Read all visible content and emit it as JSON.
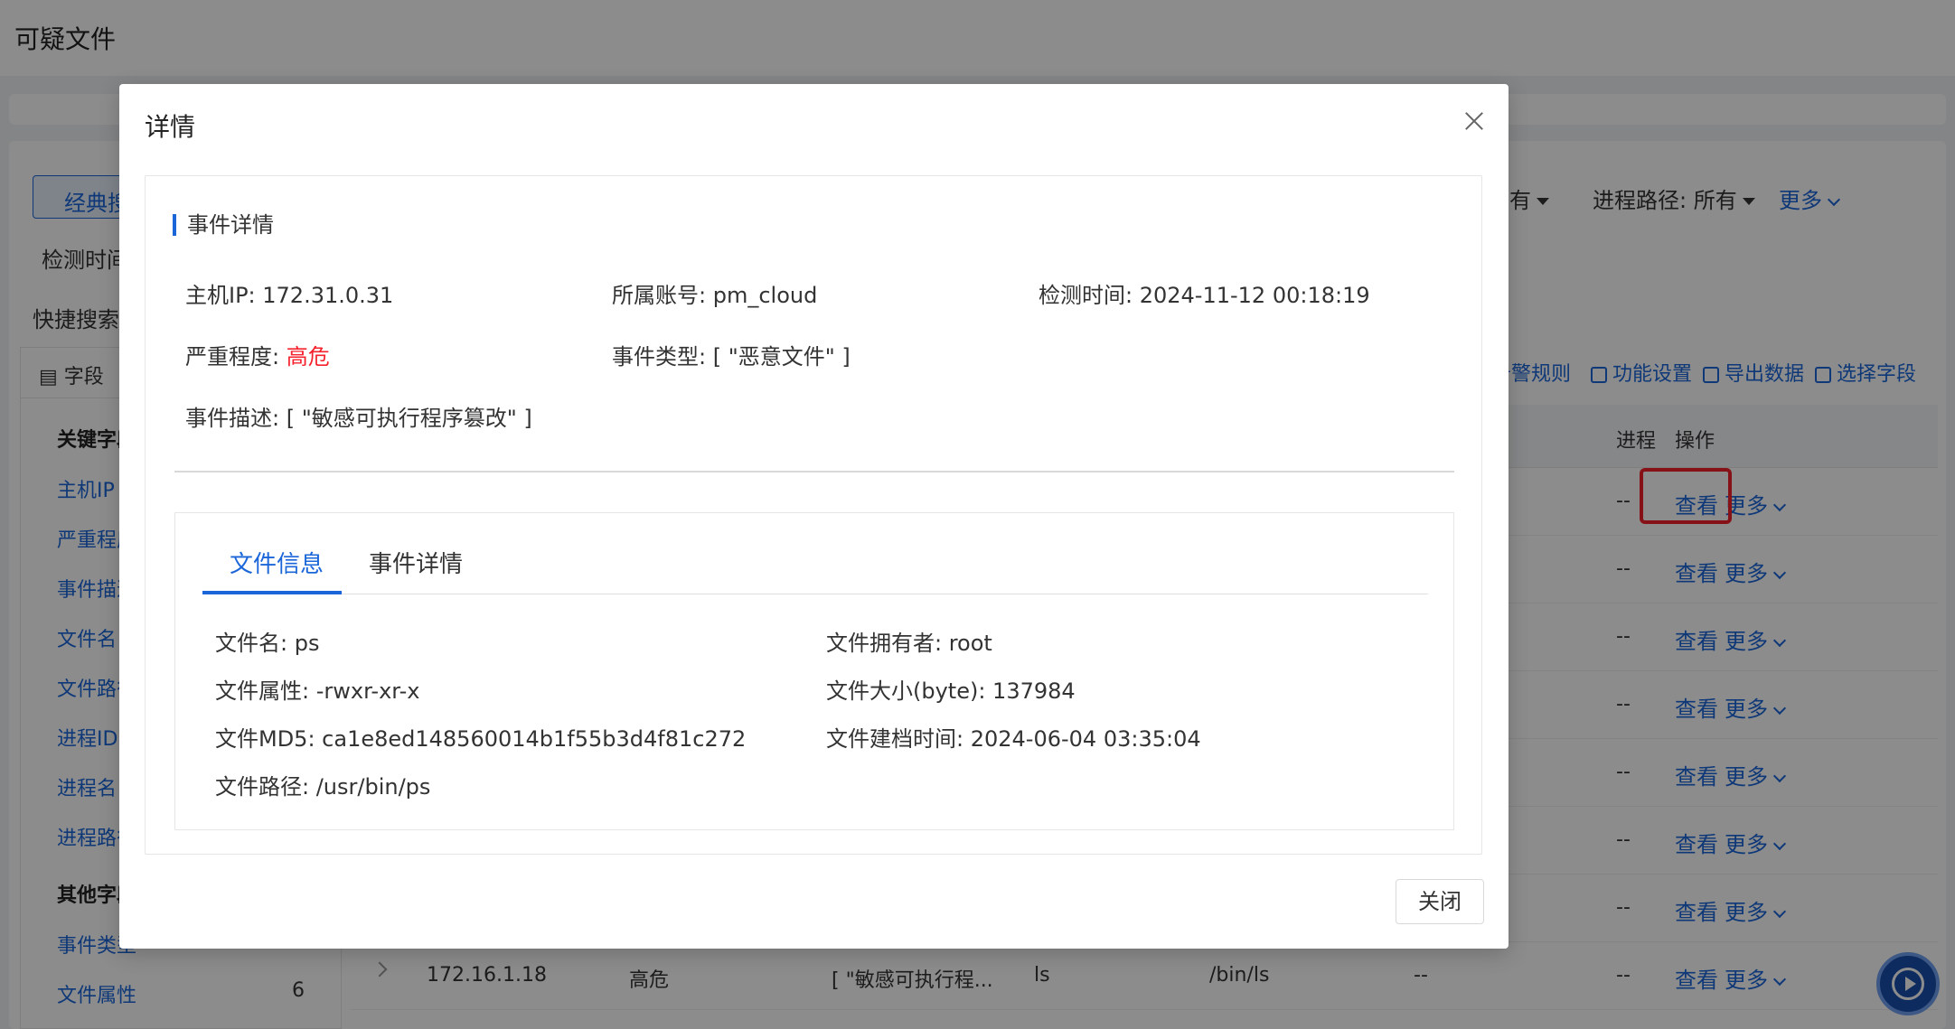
{
  "page": {
    "title": "可疑文件"
  },
  "search": {
    "classic_label": "经典搜",
    "detect_time_label": "检测时间",
    "quick_search_label": "快捷搜索",
    "filter_partial": "有",
    "process_path_filter": "进程路径: 所有",
    "more_label": "更多"
  },
  "toolbar": {
    "alert_rules": "告警规则",
    "feature_settings": "功能设置",
    "export_data": "导出数据",
    "select_fields": "选择字段"
  },
  "left_panel": {
    "header": "字段",
    "key_group": "关键字段",
    "key_items": [
      "主机IP",
      "严重程度",
      "事件描述",
      "文件名",
      "文件路径",
      "进程ID",
      "进程名",
      "进程路径"
    ],
    "other_group": "其他字段",
    "other_items": [
      {
        "label": "事件类型",
        "count": ""
      },
      {
        "label": "文件属性",
        "count": "6"
      }
    ]
  },
  "table": {
    "columns": {
      "process": "进程",
      "op": "操作"
    },
    "rows_placeholder": "--",
    "view_label": "查看",
    "more_label": "更多",
    "visible_row": {
      "ip": "172.16.1.18",
      "severity": "高危",
      "desc": "[ \"敏感可执行程...",
      "file_name": "ls",
      "file_path": "/bin/ls",
      "col6": "--",
      "col7": "--"
    }
  },
  "modal": {
    "title": "详情",
    "section_title": "事件详情",
    "host_ip": "主机IP: 172.31.0.31",
    "account": "所属账号: pm_cloud",
    "detect_time": "检测时间: 2024-11-12 00:18:19",
    "severity_label": "严重程度: ",
    "severity_value": "高危",
    "event_type": "事件类型: [ \"恶意文件\" ]",
    "event_desc": "事件描述: [ \"敏感可执行程序篡改\" ]",
    "tabs": [
      "文件信息",
      "事件详情"
    ],
    "file_info": {
      "name": "文件名: ps",
      "owner": "文件拥有者: root",
      "attr": "文件属性: -rwxr-xr-x",
      "size": "文件大小(byte): 137984",
      "md5": "文件MD5: ca1e8ed148560014b1f55b3d4f81c272",
      "ctime": "文件建档时间: 2024-06-04 03:35:04",
      "path": "文件路径: /usr/bin/ps"
    },
    "close_button": "关闭"
  },
  "colors": {
    "accent": "#1a66d9",
    "danger": "#f5222d",
    "overlay": "rgba(0,0,0,0.45)"
  }
}
